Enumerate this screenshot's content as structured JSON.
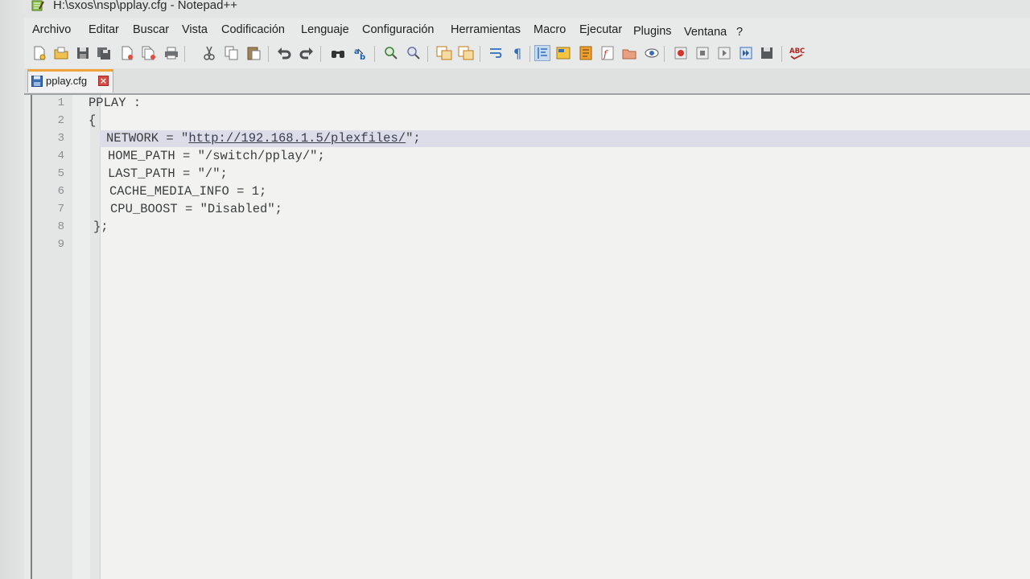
{
  "window": {
    "title": "H:\\sxos\\nsp\\pplay.cfg - Notepad++"
  },
  "menu": [
    {
      "label": "Archivo"
    },
    {
      "label": "Editar"
    },
    {
      "label": "Buscar"
    },
    {
      "label": "Vista"
    },
    {
      "label": "Codificación"
    },
    {
      "label": "Lenguaje"
    },
    {
      "label": "Configuración"
    },
    {
      "label": "Herramientas"
    },
    {
      "label": "Macro"
    },
    {
      "label": "Ejecutar"
    },
    {
      "label": "Plugins"
    },
    {
      "label": "Ventana"
    },
    {
      "label": "?"
    }
  ],
  "toolbar": {
    "icons": [
      "new-file-icon",
      "open-file-icon",
      "save-icon",
      "save-all-icon",
      "close-icon",
      "close-all-icon",
      "print-icon",
      "cut-icon",
      "copy-icon",
      "paste-icon",
      "undo-icon",
      "redo-icon",
      "find-icon",
      "replace-icon",
      "zoom-in-icon",
      "zoom-out-icon",
      "sync-vertical-icon",
      "sync-horizontal-icon",
      "word-wrap-icon",
      "show-all-characters-icon",
      "indent-guide-icon",
      "user-language-icon",
      "document-map-icon",
      "function-list-icon",
      "folder-workspace-icon",
      "monitoring-icon",
      "record-macro-icon",
      "stop-macro-icon",
      "play-macro-icon",
      "run-macro-multiple-icon",
      "save-macro-icon",
      "spell-check-icon"
    ],
    "spell_check_label": "ABC"
  },
  "tab": {
    "label": "pplay.cfg",
    "close": "×"
  },
  "editor": {
    "line_numbers": [
      "1",
      "2",
      "3",
      "4",
      "5",
      "6",
      "7",
      "8",
      "9"
    ],
    "lines": {
      "l1": "PPLAY :",
      "l2": "{",
      "l3_pre": "NETWORK = \"",
      "l3_url": "http://192.168.1.5/plexfiles/",
      "l3_post": "\";",
      "l4": "HOME_PATH = \"/switch/pplay/\";",
      "l5": "LAST_PATH = \"/\";",
      "l6": "CACHE_MEDIA_INFO = 1;",
      "l7": "CPU_BOOST = \"Disabled\";",
      "l8": "};"
    },
    "current_line": 3
  },
  "colors": {
    "current_line_highlight": "#dcdde8",
    "tab_accent": "#f0a33a",
    "tab_close": "#d94b45"
  }
}
